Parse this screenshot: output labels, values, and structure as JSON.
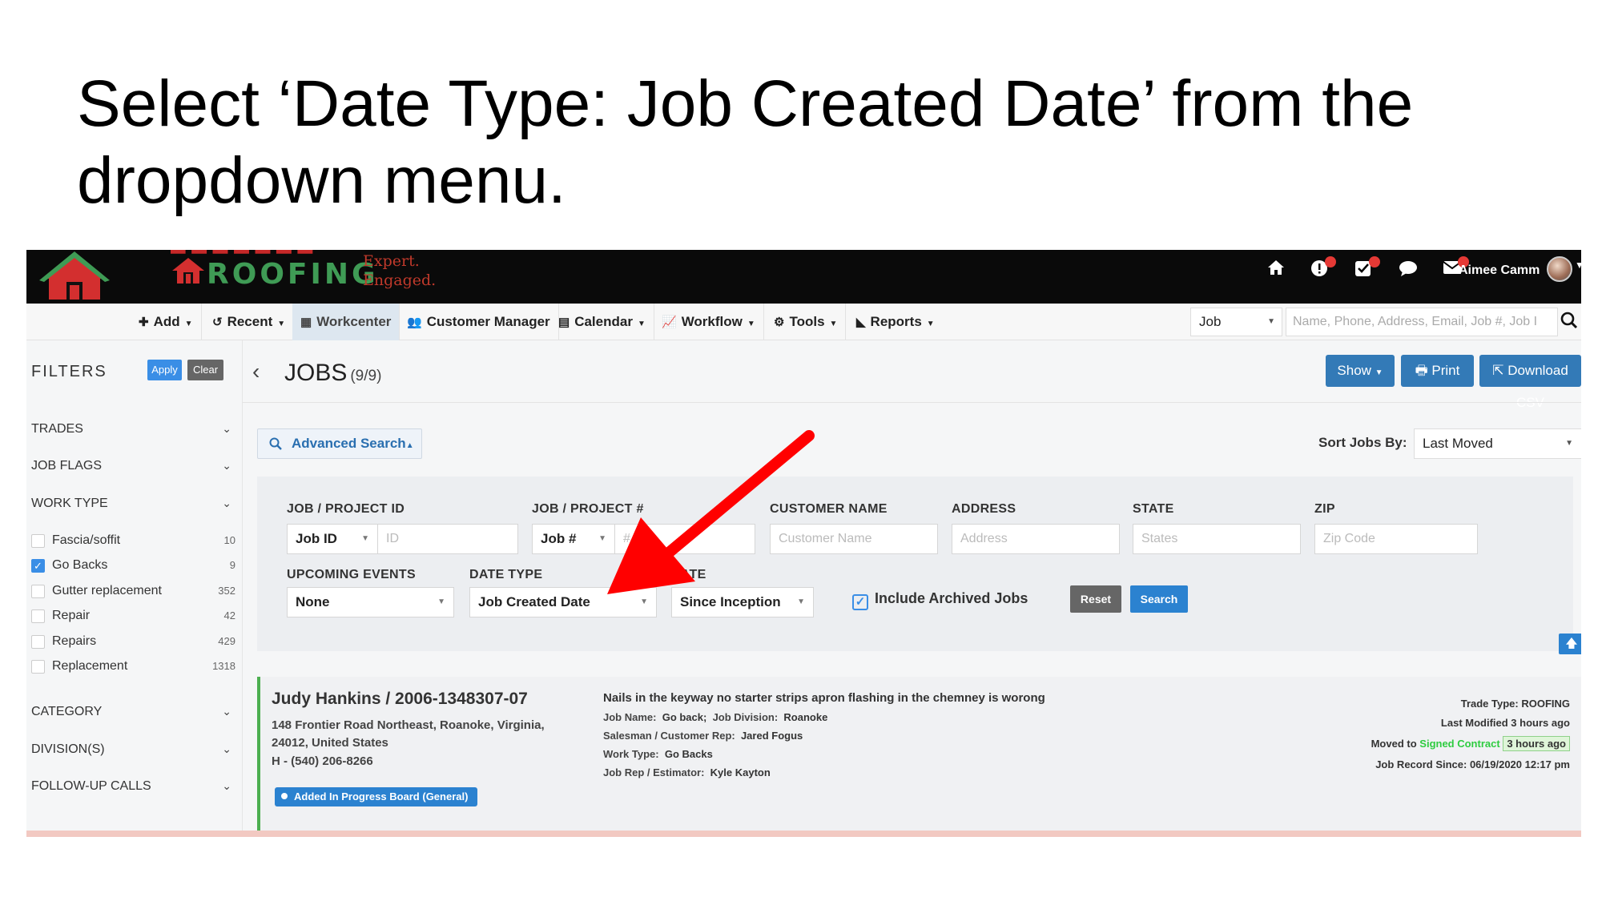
{
  "slide": {
    "title": "Select ‘Date Type: Job Created Date’ from the dropdown menu."
  },
  "brand": {
    "name": "CENVAR ROOFING",
    "name_visible": "ROOFING",
    "tagline_1": "Expert.",
    "tagline_2": "Engaged."
  },
  "header": {
    "icons": [
      "home-icon",
      "alert-icon",
      "tasks-icon",
      "chat-icon",
      "mail-icon"
    ],
    "user_name": "Aimee Camm"
  },
  "nav": {
    "items": [
      {
        "label": "Add",
        "icon": "plus-icon",
        "has_caret": true
      },
      {
        "label": "Recent",
        "icon": "history-icon",
        "has_caret": true
      },
      {
        "label": "Workcenter",
        "icon": "building-icon",
        "has_caret": false
      },
      {
        "label": "Customer Manager",
        "icon": "users-icon",
        "has_caret": false
      },
      {
        "label": "Calendar",
        "icon": "calendar-icon",
        "has_caret": true
      },
      {
        "label": "Workflow",
        "icon": "chart-line-icon",
        "has_caret": true
      },
      {
        "label": "Tools",
        "icon": "gear-icon",
        "has_caret": true
      },
      {
        "label": "Reports",
        "icon": "area-chart-icon",
        "has_caret": true
      }
    ],
    "search_type": "Job",
    "search_placeholder": "Name, Phone, Address, Email, Job #, Job I"
  },
  "filters": {
    "title": "FILTERS",
    "apply_label": "Apply",
    "clear_label": "Clear",
    "sections": {
      "trades": "TRADES",
      "job_flags": "JOB FLAGS",
      "work_type": "WORK TYPE",
      "category": "CATEGORY",
      "divisions": "DIVISION(S)",
      "followup": "FOLLOW-UP CALLS"
    },
    "work_types": [
      {
        "label": "Fascia/soffit",
        "count": "10",
        "checked": false
      },
      {
        "label": "Go Backs",
        "count": "9",
        "checked": true
      },
      {
        "label": "Gutter replacement",
        "count": "352",
        "checked": false
      },
      {
        "label": "Repair",
        "count": "42",
        "checked": false
      },
      {
        "label": "Repairs",
        "count": "429",
        "checked": false
      },
      {
        "label": "Replacement",
        "count": "1318",
        "checked": false
      }
    ]
  },
  "jobs": {
    "title": "JOBS",
    "count": "(9/9)",
    "show_label": "Show",
    "print_label": "Print",
    "download_label": "Download CSV"
  },
  "search": {
    "advanced_label": "Advanced Search",
    "sort_label": "Sort Jobs By:",
    "sort_value": "Last Moved",
    "fields": {
      "job_project_id": {
        "label": "JOB / PROJECT ID",
        "select": "Job ID",
        "placeholder": "ID"
      },
      "job_project_num": {
        "label": "JOB / PROJECT #",
        "select": "Job #",
        "placeholder": "#"
      },
      "customer_name": {
        "label": "CUSTOMER NAME",
        "placeholder": "Customer Name"
      },
      "address": {
        "label": "ADDRESS",
        "placeholder": "Address"
      },
      "state": {
        "label": "STATE",
        "placeholder": "States"
      },
      "zip": {
        "label": "ZIP",
        "placeholder": "Zip Code"
      },
      "upcoming_events": {
        "label": "UPCOMING EVENTS",
        "value": "None"
      },
      "date_type": {
        "label": "DATE TYPE",
        "value": "Job Created Date"
      },
      "date": {
        "label": "DATE",
        "value": "Since Inception"
      }
    },
    "include_archived": "Include Archived Jobs",
    "reset_label": "Reset",
    "search_label": "Search"
  },
  "job_card": {
    "title": "Judy Hankins / 2006-1348307-07",
    "address": "148 Frontier Road Northeast, Roanoke, Virginia, 24012, United States",
    "phone": "H - (540) 206-8266",
    "tag": "Added In Progress Board (General)",
    "description": "Nails in the keyway no starter strips apron flashing in the chemney is worong",
    "job_name_k": "Job Name:",
    "job_name_v": "Go back;",
    "job_division_k": "Job Division:",
    "job_division_v": "Roanoke",
    "salesman_k": "Salesman / Customer Rep:",
    "salesman_v": "Jared Fogus",
    "work_type_k": "Work Type:",
    "work_type_v": "Go Backs",
    "estimator_k": "Job Rep / Estimator:",
    "estimator_v": "Kyle Kayton",
    "trade_type": "Trade Type: ROOFING",
    "last_modified": "Last Modified 3 hours ago",
    "moved_to_prefix": "Moved to",
    "moved_to_stage": "Signed Contract",
    "moved_ago": "3 hours ago",
    "record_since": "Job Record Since: 06/19/2020 12:17 pm"
  },
  "colors": {
    "accent": "#337ab7",
    "brand_green": "#3f9b55",
    "brand_red": "#c62828",
    "annotation_arrow": "#ff0000",
    "status_green": "#4caf50"
  }
}
